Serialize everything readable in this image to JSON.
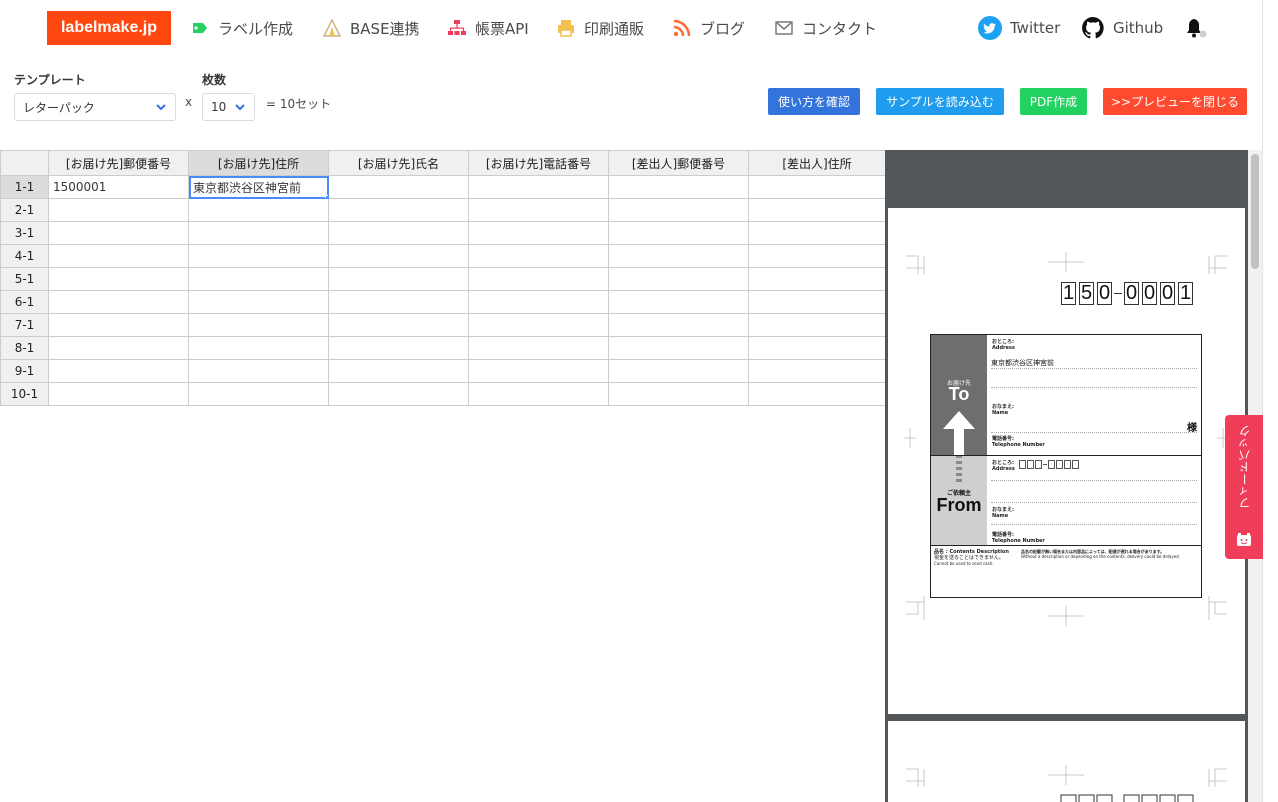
{
  "nav": {
    "brand": "labelmake.jp",
    "items": [
      "ラベル作成",
      "BASE連携",
      "帳票API",
      "印刷通販",
      "ブログ",
      "コンタクト"
    ],
    "twitter": "Twitter",
    "github": "Github"
  },
  "controls": {
    "template_label": "テンプレート",
    "template_value": "レターパック",
    "count_label": "枚数",
    "times": "x",
    "count_value": "10",
    "sets_text": "= 10セット"
  },
  "buttons": {
    "howto": "使い方を確認",
    "sample": "サンプルを読み込む",
    "pdf": "PDF作成",
    "close_preview": ">>プレビューを閉じる"
  },
  "colors": {
    "brand": "#ff470f",
    "howto": "#3273dc",
    "sample": "#209cee",
    "pdf": "#23d160",
    "close_preview": "#ff3860",
    "feedback": "#ef3d5a"
  },
  "grid": {
    "headers": [
      "[お届け先]郵便番号",
      "[お届け先]住所",
      "[お届け先]氏名",
      "[お届け先]電話番号",
      "[差出人]郵便番号",
      "[差出人]住所"
    ],
    "rows": [
      {
        "label": "1-1",
        "cells": [
          "1500001",
          "東京都渋谷区神宮前",
          "",
          "",
          "",
          ""
        ]
      },
      {
        "label": "2-1",
        "cells": [
          "",
          "",
          "",
          "",
          "",
          ""
        ]
      },
      {
        "label": "3-1",
        "cells": [
          "",
          "",
          "",
          "",
          "",
          ""
        ]
      },
      {
        "label": "4-1",
        "cells": [
          "",
          "",
          "",
          "",
          "",
          ""
        ]
      },
      {
        "label": "5-1",
        "cells": [
          "",
          "",
          "",
          "",
          "",
          ""
        ]
      },
      {
        "label": "6-1",
        "cells": [
          "",
          "",
          "",
          "",
          "",
          ""
        ]
      },
      {
        "label": "7-1",
        "cells": [
          "",
          "",
          "",
          "",
          "",
          ""
        ]
      },
      {
        "label": "8-1",
        "cells": [
          "",
          "",
          "",
          "",
          "",
          ""
        ]
      },
      {
        "label": "9-1",
        "cells": [
          "",
          "",
          "",
          "",
          "",
          ""
        ]
      },
      {
        "label": "10-1",
        "cells": [
          "",
          "",
          "",
          "",
          "",
          ""
        ]
      }
    ]
  },
  "preview": {
    "zip_digits": [
      "1",
      "5",
      "0",
      "0",
      "0",
      "0",
      "1"
    ],
    "to_jp": "お届け先",
    "to_en": "To",
    "from_jp": "ご依頼主",
    "from_en": "From",
    "address_jp": "おところ:",
    "address_en": "Address",
    "name_jp": "おなまえ:",
    "name_en": "Name",
    "tel_jp": "電話番号:",
    "tel_en": "Telephone Number",
    "address_value": "東京都渋谷区神宮前",
    "honorific": "様",
    "contents_jp": "品名 : Contents Description",
    "contents_note1": "現金を送ることはできません。",
    "contents_note2": "Cannot be used to send cash.",
    "contents_note3": "品名の記載が無い場合または内容品によっては、配達が遅れる場合があります。",
    "contents_note4": "Without a description or depending on the contents, delivery could be delayed."
  },
  "feedback": "フィードバック"
}
